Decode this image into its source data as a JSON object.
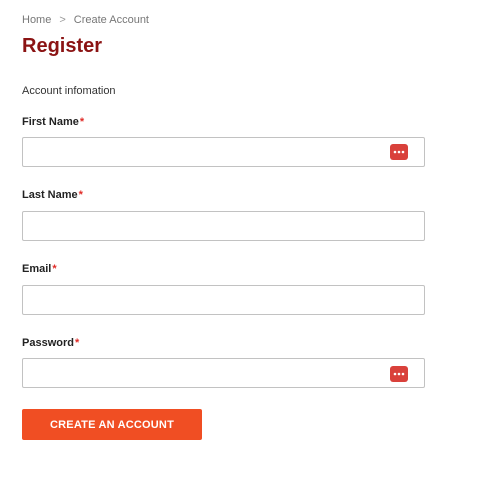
{
  "breadcrumb": {
    "home": "Home",
    "separator": ">",
    "current": "Create Account"
  },
  "page_title": "Register",
  "section_label": "Account infomation",
  "fields": {
    "first_name": {
      "label": "First Name",
      "required": "*",
      "value": "",
      "icon": "password-manager-icon"
    },
    "last_name": {
      "label": "Last Name",
      "required": "*",
      "value": ""
    },
    "email": {
      "label": "Email",
      "required": "*",
      "value": ""
    },
    "password": {
      "label": "Password",
      "required": "*",
      "value": "",
      "icon": "password-manager-icon"
    }
  },
  "submit_button": {
    "label": "CREATE AN ACCOUNT"
  },
  "colors": {
    "title": "#8b1313",
    "required": "#e02b27",
    "button": "#f04e23",
    "pm_icon": "#d9413b"
  }
}
